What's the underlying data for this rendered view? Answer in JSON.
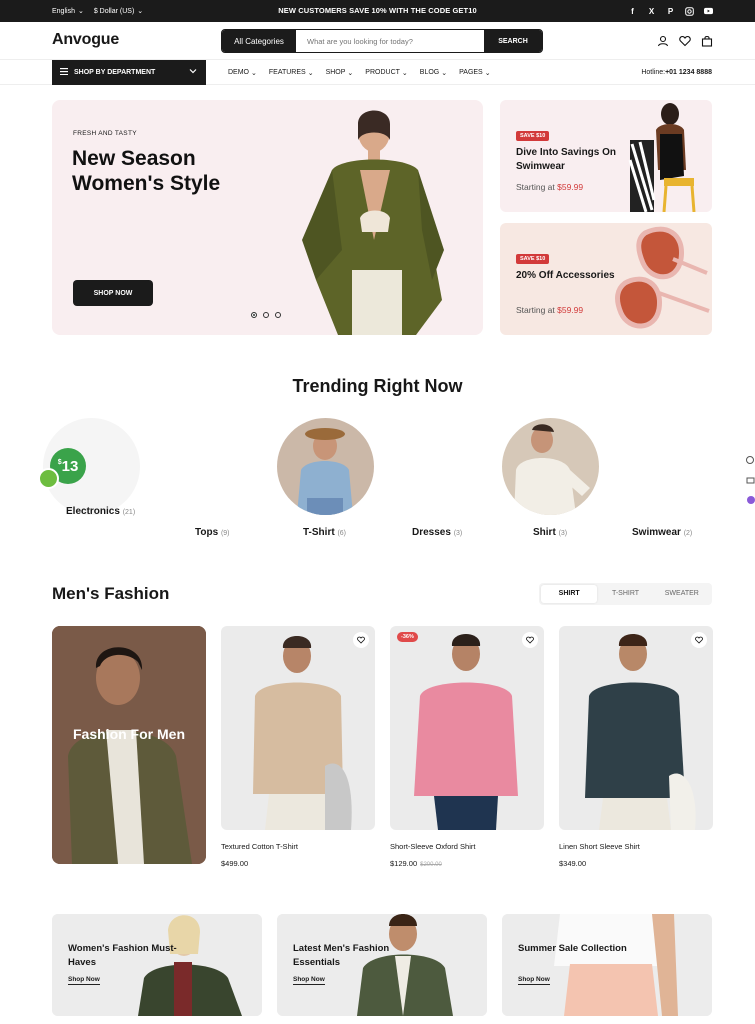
{
  "topbar": {
    "language": "English",
    "currency": "$ Dollar (US)",
    "promo": "NEW CUSTOMERS SAVE 10% WITH THE CODE GET10",
    "social_icons": [
      "facebook-icon",
      "x-icon",
      "pinterest-icon",
      "instagram-icon",
      "youtube-icon"
    ]
  },
  "header": {
    "logo": "Anvogue",
    "category_select": "All Categories",
    "search_placeholder": "What are you looking for today?",
    "search_button": "SEARCH",
    "icons": [
      "user-icon",
      "heart-icon",
      "bag-icon"
    ]
  },
  "nav": {
    "department": "SHOP BY DEPARTMENT",
    "menu": [
      "DEMO",
      "FEATURES",
      "SHOP",
      "PRODUCT",
      "BLOG",
      "PAGES"
    ],
    "hotline_label": "Hotline:",
    "hotline_number": "+01 1234 8888"
  },
  "hero": {
    "eyebrow": "FRESH AND TASTY",
    "title": "New Season Women's Style",
    "button": "SHOP NOW",
    "slides": 3,
    "active_slide": 1
  },
  "promos": [
    {
      "badge": "SAVE $10",
      "title": "Dive Into Savings On Swimwear",
      "price_prefix": "Starting at ",
      "price": "$59.99"
    },
    {
      "badge": "SAVE $10",
      "title": "20% Off Accessories",
      "price_prefix": "Starting at ",
      "price": "$59.99"
    }
  ],
  "trending": {
    "title": "Trending Right Now",
    "price_badge_currency": "$",
    "price_badge_value": "13",
    "categories": [
      {
        "name": "Electronics",
        "count": "(21)"
      },
      {
        "name": "Tops",
        "count": "(9)"
      },
      {
        "name": "T-Shirt",
        "count": "(6)"
      },
      {
        "name": "Dresses",
        "count": "(3)"
      },
      {
        "name": "Shirt",
        "count": "(3)"
      },
      {
        "name": "Swimwear",
        "count": "(2)"
      }
    ]
  },
  "mens": {
    "title": "Men's Fashion",
    "tabs": [
      "SHIRT",
      "T-SHIRT",
      "SWEATER"
    ],
    "active_tab": "SHIRT",
    "feature_label": "Fashion For Men",
    "products": [
      {
        "name": "Textured Cotton T-Shirt",
        "price": "$499.00",
        "old_price": "",
        "discount": ""
      },
      {
        "name": "Short-Sleeve Oxford Shirt",
        "price": "$129.00",
        "old_price": "$200.00",
        "discount": "-36%"
      },
      {
        "name": "Linen Short Sleeve Shirt",
        "price": "$349.00",
        "old_price": "",
        "discount": ""
      }
    ]
  },
  "banners": [
    {
      "title": "Women's Fashion Must-Haves",
      "link": "Shop Now"
    },
    {
      "title": "Latest Men's Fashion Essentials",
      "link": "Shop Now"
    },
    {
      "title": "Summer Sale Collection",
      "link": "Shop Now"
    }
  ],
  "colors": {
    "dark": "#1b1b1b",
    "hero_bg": "#f9eef0",
    "sale_red": "#d23a3a",
    "badge_green": "#3aa34a"
  }
}
